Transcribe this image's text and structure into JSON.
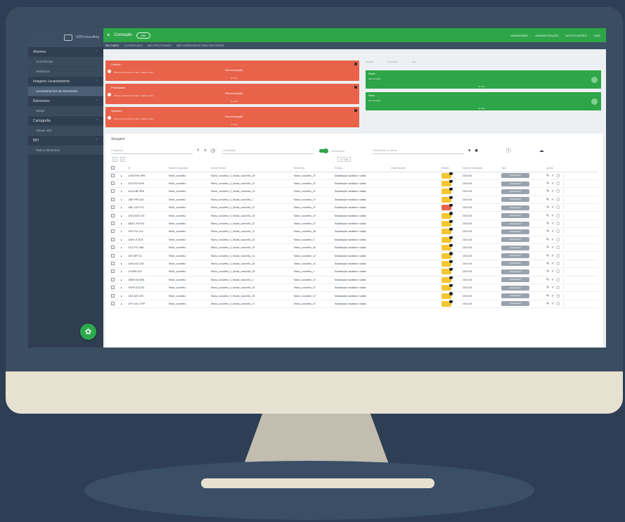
{
  "colors": {
    "background": "#2e3f55",
    "sidebar": "#2f3e50",
    "topbar": "#2ea548",
    "alert_red": "#e8634a",
    "alert_green": "#2ea548",
    "pill_yellow": "#f3c531",
    "pill_orange": "#ef8a2c",
    "pill_red": "#e8634a"
  },
  "sidebar": {
    "logo_text": "GRPconsulting",
    "fab_icon": "gear-icon",
    "sections": [
      {
        "label": "Alarmes",
        "items": [
          {
            "label": "Ocorrências"
          },
          {
            "label": "Históricos"
          }
        ]
      },
      {
        "label": "Imagens Levantamento",
        "items": [
          {
            "label": "Levantamentos de Elementos",
            "active": true
          }
        ]
      },
      {
        "label": "Elementos",
        "items": [
          {
            "label": "Sinais"
          }
        ]
      },
      {
        "label": "Cartografia",
        "items": [
          {
            "label": "Viewer SIG"
          }
        ]
      },
      {
        "label": "BPI",
        "items": [
          {
            "label": "Todos elementos"
          }
        ]
      }
    ]
  },
  "topbar": {
    "menu_icon": "hamburger-icon",
    "title": "Concepto",
    "toggle": "ON",
    "links": [
      "DASHBOARD",
      "ADMINISTRAÇÃO",
      "NOTIFICAÇÕES",
      "SAIR"
    ]
  },
  "subtabs": [
    "EM CURSO",
    "CLASSIFICADO",
    "NÃO PROCESSADO",
    "NÃO CARREGADOS PARA PROCESSAR"
  ],
  "alerts_red": [
    {
      "title": "Celeste",
      "sub": "Última ocorrência há 2 dias · Estado: Ativo",
      "status": "Sincronização",
      "foot": "ver mais"
    },
    {
      "title": "Prioridades",
      "sub": "Última ocorrência há 5 dias · Estado: Ativo",
      "status": "Sincronização",
      "foot": "ver mais"
    },
    {
      "title": "Salvador",
      "sub": "Última ocorrência há 9 dias · Estado: Ativo",
      "status": "Sincronização",
      "foot": "ver mais"
    }
  ],
  "alerts_green": [
    {
      "title": "Sinais",
      "sub": "Sincronizado",
      "foot": "ver mais"
    },
    {
      "title": "Setas",
      "sub": "Sincronizado",
      "foot": "ver mais"
    }
  ],
  "filters": [
    "Distrito",
    "Concelho",
    "Ano"
  ],
  "table": {
    "title": "Sinagem",
    "search_placeholder": "Pesquisar",
    "select_placeholder": "Localidade",
    "switch_label": "Elementos",
    "select2_placeholder": "Selecionar os filtros",
    "pager_pages": [
      "1",
      "2"
    ],
    "pager_right": "1 / 3 ▸",
    "columns": [
      "",
      "",
      "ID",
      "Data de Inspeção",
      "Nome ficheiro",
      "Elemento",
      "Estado",
      "Observações",
      "Estado",
      "Data de Avaliação",
      "Tipo",
      "Ações"
    ],
    "rows": [
      {
        "id": "1/2W-FHH-9PB",
        "date": "Rede_concelho",
        "file": "Ramo_concelho_0_Sinais_concelho_29",
        "elem": "Ramo_concelho_37",
        "state": "Sinalização mantida e valida",
        "status": "yellow",
        "eval": "2019-05",
        "tipo": "Encaminhar"
      },
      {
        "id": "3/2V-PEV-R4H",
        "date": "Rede_concelho",
        "file": "Ramo_concelho_0_Sinais_concelho_14",
        "elem": "Ramo_concelho_37",
        "state": "Sinalização mantida e valida",
        "status": "yellow",
        "eval": "2019-05",
        "tipo": "Encaminhar"
      },
      {
        "id": "3/1A-KBF-9EB",
        "date": "Rede_concelho",
        "file": "Ramo_concelho_0_Sinais_concelho_13",
        "elem": "Ramo_concelho_37",
        "state": "Sinalização mantida e valida",
        "status": "yellow",
        "eval": "2019-05",
        "tipo": "Encaminhar"
      },
      {
        "id": "1/BF-PRV-A21",
        "date": "Rede_concelho",
        "file": "Ramo_concelho_0_Sinais_concelho_7",
        "elem": "Ramo_concelho_37",
        "state": "Sinalização mantida e valida",
        "status": "yellow",
        "eval": "2019-05",
        "tipo": "Encaminhar"
      },
      {
        "id": "1/BL-VXX-F2C",
        "date": "Rede_concelho",
        "file": "Ramo_concelho_0_Sinais_concelho_27",
        "elem": "Ramo_concelho_37",
        "state": "Sinalização mantida e valida",
        "status": "red",
        "eval": "2019-05",
        "tipo": "Encaminhar"
      },
      {
        "id": "1/SH-NVD-V2T",
        "date": "Rede_concelho",
        "file": "Ramo_concelho_0_Sinais_concelho_26",
        "elem": "Ramo_concelho_37",
        "state": "Sinalização mantida e valida",
        "status": "yellow",
        "eval": "2019-05",
        "tipo": "Encaminhar"
      },
      {
        "id": "3/BZU-TW-S11",
        "date": "Rede_concelho",
        "file": "Ramo_concelho_0_Sinais_concelho_22",
        "elem": "Ramo_concelho_37",
        "state": "Sinalização mantida e valida",
        "status": "yellow",
        "eval": "2019-05",
        "tipo": "Encaminhar"
      },
      {
        "id": "1/FR-F11-143",
        "date": "Rede_concelho",
        "file": "Ramo_concelho_0_Sinais_concelho_11",
        "elem": "Ramo_concelho_38",
        "state": "Sinalização mantida e valida",
        "status": "yellow",
        "eval": "2019-05",
        "tipo": "Encaminhar"
      },
      {
        "id": "1/8HY-IT-ECE",
        "date": "Rede_concelho",
        "file": "Ramo_concelho_0_Sinais_concelho_23",
        "elem": "Ramo_concelho_3",
        "state": "Sinalização mantida e valida",
        "status": "yellow",
        "eval": "2019-05",
        "tipo": "Encaminhar"
      },
      {
        "id": "1/CZ-FX7-ABL",
        "date": "Rede_concelho",
        "file": "Ramo_concelho_0_Sinais_concelho_15",
        "elem": "Ramo_concelho_40",
        "state": "Sinalização mantida e valida",
        "status": "yellow",
        "eval": "2019-05",
        "tipo": "Encaminhar"
      },
      {
        "id": "1/ET-6FF-VL",
        "date": "Rede_concelho",
        "file": "Ramo_concelho_0_Sinais_concelho_14",
        "elem": "Ramo_concelho_12",
        "state": "Sinalização mantida e valida",
        "status": "yellow",
        "eval": "2019-05",
        "tipo": "Encaminhar"
      },
      {
        "id": "1/DN-V22-TAV",
        "date": "Rede_concelho",
        "file": "Ramo_concelho_0_Sinais_concelho_25",
        "elem": "Ramo_concelho_12",
        "state": "Sinalização mantida e valida",
        "status": "yellow",
        "eval": "2019-05",
        "tipo": "Encaminhar"
      },
      {
        "id": "1/YDRR-6LE",
        "date": "Rede_concelho",
        "file": "Ramo_concelho_0_Sinais_concelho_18",
        "elem": "Ramo_concelho_1",
        "state": "Sinalização mantida e valida",
        "status": "yellow",
        "eval": "2019-05",
        "tipo": "Encaminhar"
      },
      {
        "id": "1/BKH-N0-8E5",
        "date": "Rede_concelho",
        "file": "Ramo_concelho_0_Sinais_concelho_2",
        "elem": "Ramo_concelho_37",
        "state": "Sinalização mantida e valida",
        "status": "yellow",
        "eval": "2019-05",
        "tipo": "Encaminhar"
      },
      {
        "id": "1/HPE-E1S-K5",
        "date": "Rede_concelho",
        "file": "Ramo_concelho_0_Sinais_concelho_29",
        "elem": "Ramo_concelho_37",
        "state": "Sinalização mantida e valida",
        "status": "yellow",
        "eval": "2019-05",
        "tipo": "Encaminhar"
      },
      {
        "id": "1/EZ-BGT-4PJ",
        "date": "Rede_concelho",
        "file": "Ramo_concelho_0_Sinais_concelho_25",
        "elem": "Ramo_concelho_37",
        "state": "Sinalização mantida e valida",
        "status": "yellow",
        "eval": "2019-05",
        "tipo": "Encaminhar"
      },
      {
        "id": "1/FT1-9LL-FEP",
        "date": "Rede_concelho",
        "file": "Ramo_concelho_0_Sinais_concelho_17",
        "elem": "Ramo_concelho_37",
        "state": "Sinalização mantida e valida",
        "status": "yellow",
        "eval": "2019-05",
        "tipo": "Encaminhar"
      }
    ]
  }
}
